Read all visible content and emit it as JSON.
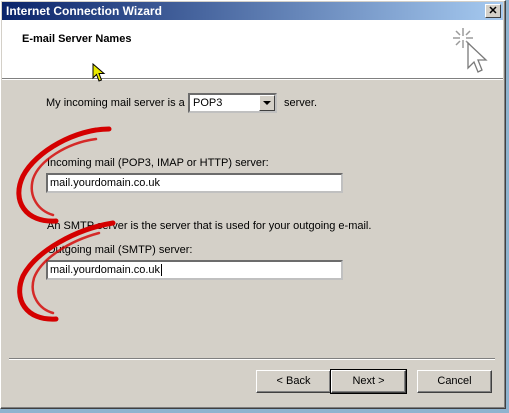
{
  "window": {
    "title": "Internet Connection Wizard",
    "close_glyph": "✕"
  },
  "header": {
    "title": "E-mail Server Names"
  },
  "incoming_type": {
    "label_before": "My incoming mail server is a",
    "selected": "POP3",
    "label_after": "server."
  },
  "incoming": {
    "label": "Incoming mail (POP3, IMAP or HTTP) server:",
    "value": "mail.yourdomain.co.uk"
  },
  "smtp_note": "An SMTP server is the server that is used for your outgoing e-mail.",
  "outgoing": {
    "label": "Outgoing mail (SMTP) server:",
    "value": "mail.yourdomain.co.uk"
  },
  "buttons": {
    "back": "< Back",
    "next": "Next >",
    "cancel": "Cancel"
  },
  "colors": {
    "title_bar_start": "#0a246a",
    "title_bar_end": "#a6caf0",
    "annotation_red": "#d40000"
  },
  "icons": [
    "close-icon",
    "wizard-wand-icon",
    "arrow-cursor-icon",
    "dropdown-arrow-icon"
  ]
}
